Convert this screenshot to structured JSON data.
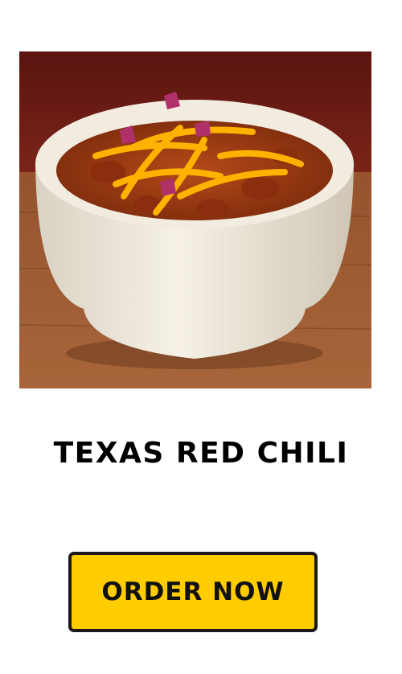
{
  "product": {
    "image_alt": "Texas Red Chili",
    "name": "TEXAS RED CHILI"
  },
  "cta": {
    "label": "ORDER NOW"
  },
  "colors": {
    "button_bg": "#ffcc00",
    "button_border": "#1a1a1a",
    "text": "#000000",
    "background": "#ffffff"
  }
}
